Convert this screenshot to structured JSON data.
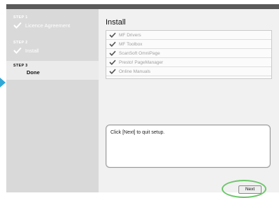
{
  "wizard": {
    "steps": [
      {
        "number": "STEP 1",
        "label": "Licence Agreement"
      },
      {
        "number": "STEP 2",
        "label": "Install"
      },
      {
        "number": "STEP 3",
        "label": "Done"
      }
    ]
  },
  "main": {
    "title": "Install",
    "items": [
      {
        "label": "MF Drivers"
      },
      {
        "label": "MF Toolbox"
      },
      {
        "label": "ScanSoft OmniPage"
      },
      {
        "label": "Presto! PageManager"
      },
      {
        "label": "Online Manuals"
      }
    ],
    "message": "Click [Next] to quit setup."
  },
  "buttons": {
    "next_label": "Next"
  },
  "colors": {
    "highlight": "#6dc66a",
    "pointer_arrow": "#2fa8d8",
    "sidebar_bg": "#d9d9d9",
    "main_bg": "#f1f1f1"
  }
}
